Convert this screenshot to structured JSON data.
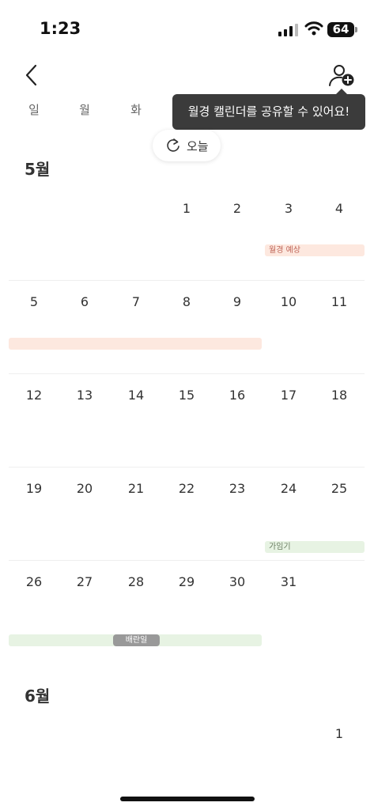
{
  "status": {
    "time": "1:23",
    "battery": "64"
  },
  "tooltip": {
    "text": "월경 캘린더를 공유할 수 있어요!"
  },
  "weekdays": [
    "일",
    "월",
    "화"
  ],
  "today_button": {
    "label": "오늘"
  },
  "may": {
    "title": "5월",
    "weeks": [
      [
        "",
        "",
        "",
        "1",
        "2",
        "3",
        "4"
      ],
      [
        "5",
        "6",
        "7",
        "8",
        "9",
        "10",
        "11"
      ],
      [
        "12",
        "13",
        "14",
        "15",
        "16",
        "17",
        "18"
      ],
      [
        "19",
        "20",
        "21",
        "22",
        "23",
        "24",
        "25"
      ],
      [
        "26",
        "27",
        "28",
        "29",
        "30",
        "31",
        ""
      ]
    ],
    "events": {
      "period_expected": "월경 예상",
      "fertile": "가임기",
      "ovulation": "배란일"
    }
  },
  "june": {
    "title": "6월",
    "first_week": [
      "",
      "",
      "",
      "",
      "",
      "",
      "1"
    ]
  },
  "colors": {
    "period_bar": "#fde8df",
    "period_text": "#c0675a",
    "fertile_bar": "#e7f3e3",
    "fertile_text": "#6b7d62",
    "ovulation_pill": "#999999"
  }
}
